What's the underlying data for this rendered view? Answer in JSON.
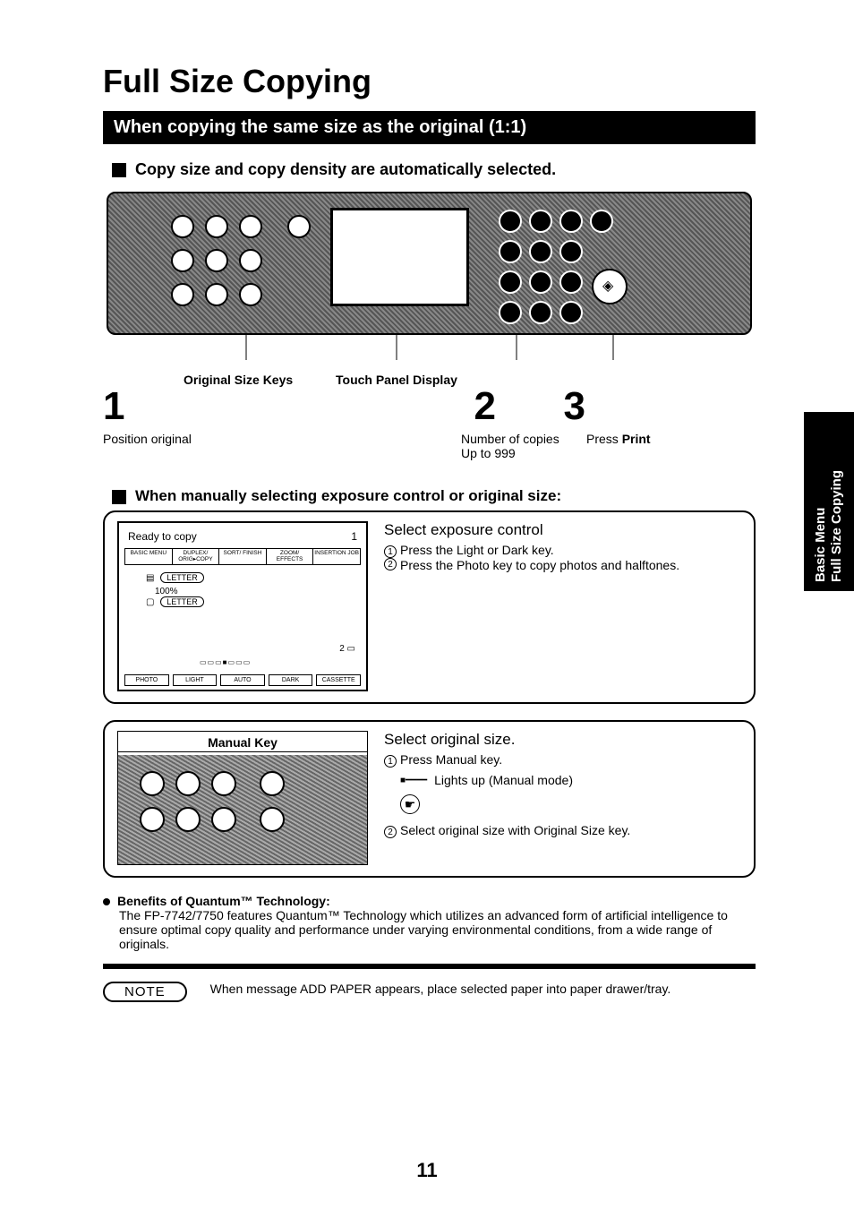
{
  "title": "Full Size Copying",
  "section_header": "When copying the same size as the original (1:1)",
  "auto_line": "Copy size and copy density are automatically selected.",
  "labels": {
    "orig_keys": "Original Size Keys",
    "touch_panel": "Touch Panel Display"
  },
  "steps": {
    "s1_num": "1",
    "s1_text": "Position original",
    "s2_num": "2",
    "s2_text_a": "Number of copies",
    "s2_text_b": "Up to 999",
    "s3_num": "3",
    "s3_text_a": "Press ",
    "s3_text_b": "Print"
  },
  "manual_header": "When manually selecting exposure control or original size:",
  "lcd": {
    "ready": "Ready to copy",
    "count": "1",
    "tabs": [
      "BASIC MENU",
      "DUPLEX/\nORIG▸COPY",
      "SORT/\nFINISH",
      "ZOOM/\nEFFECTS",
      "INSERTION\nJOB"
    ],
    "letter": "LETTER",
    "pct": "100%",
    "tray2": "2",
    "bot": [
      "PHOTO",
      "LIGHT",
      "AUTO",
      "DARK",
      "CASSETTE"
    ]
  },
  "exposure": {
    "title": "Select exposure control",
    "i1": "Press the Light or Dark key.",
    "i2": "Press the Photo key to copy photos and halftones."
  },
  "manual_key_label": "Manual Key",
  "orig_size": {
    "title": "Select original size.",
    "i1": "Press Manual key.",
    "lights": "Lights up (Manual mode)",
    "i2": "Select original size with Original Size key."
  },
  "benefits": {
    "heading": "Benefits of Quantum™ Technology:",
    "body": "The FP-7742/7750 features Quantum™ Technology which utilizes an advanced form of artificial intelligence to ensure optimal copy quality and performance under varying environmental conditions, from a wide range of originals."
  },
  "note": {
    "label": "NOTE",
    "text": "When message ADD PAPER appears, place selected paper into paper drawer/tray."
  },
  "page_number": "11",
  "side_tab": {
    "line1": "Basic Menu",
    "line2": "Full Size Copying"
  }
}
